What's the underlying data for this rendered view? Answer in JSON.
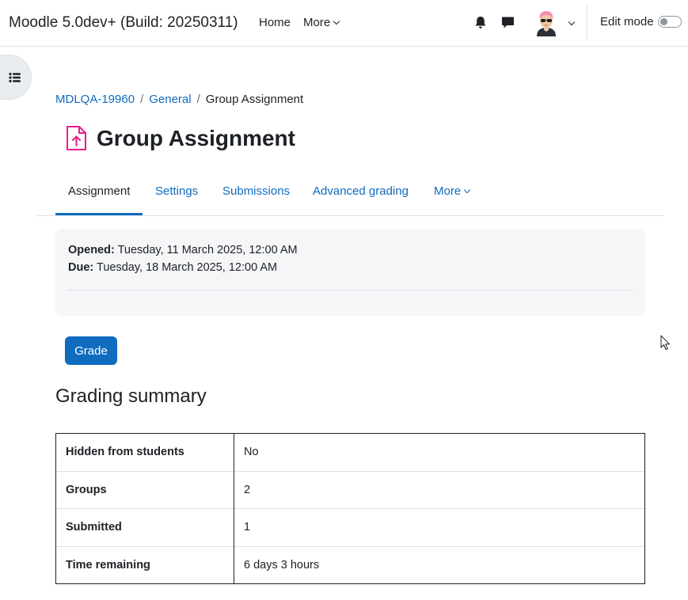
{
  "navbar": {
    "brand": "Moodle 5.0dev+ (Build: 20250311)",
    "home": "Home",
    "more": "More",
    "edit_mode": "Edit mode",
    "edit_mode_on": false,
    "icons": [
      "bell-icon",
      "chat-icon",
      "user-avatar",
      "chevron-down-icon"
    ]
  },
  "breadcrumb": {
    "items": [
      "MDLQA-19960",
      "General"
    ],
    "current": "Group Assignment",
    "separator": "/"
  },
  "page": {
    "title": "Group Assignment",
    "icon": "assignment-upload-icon",
    "accent_color": "#e91e8c"
  },
  "tabs": [
    "Assignment",
    "Settings",
    "Submissions",
    "Advanced grading",
    "More"
  ],
  "dates": {
    "opened_label": "Opened:",
    "opened_value": "Tuesday, 11 March 2025, 12:00 AM",
    "due_label": "Due:",
    "due_value": "Tuesday, 18 March 2025, 12:00 AM"
  },
  "grade_button": "Grade",
  "summary": {
    "heading": "Grading summary",
    "rows": [
      {
        "key": "Hidden from students",
        "value": "No"
      },
      {
        "key": "Groups",
        "value": "2"
      },
      {
        "key": "Submitted",
        "value": "1"
      },
      {
        "key": "Time remaining",
        "value": "6 days 3 hours"
      }
    ]
  },
  "colors": {
    "primary": "#0f6cbf",
    "text": "#1d2125",
    "panel_bg": "#f5f6f8"
  }
}
